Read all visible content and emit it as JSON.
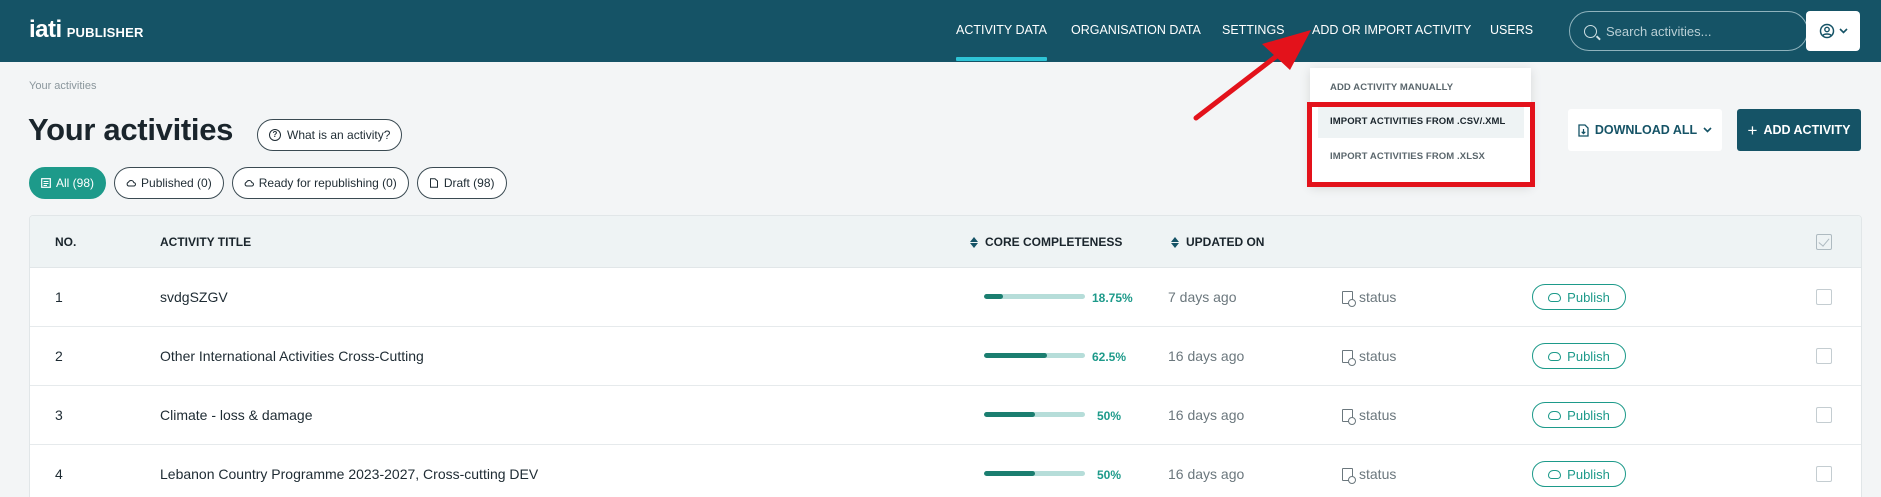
{
  "header": {
    "logo_main": "iati",
    "logo_sub": "PUBLISHER",
    "nav": [
      {
        "label": "ACTIVITY DATA",
        "active": true
      },
      {
        "label": "ORGANISATION DATA",
        "active": false
      },
      {
        "label": "SETTINGS",
        "active": false
      },
      {
        "label": "ADD OR IMPORT ACTIVITY",
        "active": false
      },
      {
        "label": "USERS",
        "active": false
      }
    ],
    "search_placeholder": "Search activities...",
    "user_icon": "user-circle-icon"
  },
  "dropdown": {
    "items": [
      {
        "label": "ADD ACTIVITY MANUALLY"
      },
      {
        "label": "IMPORT ACTIVITIES FROM .CSV/.XML"
      },
      {
        "label": "IMPORT ACTIVITIES FROM .XLSX"
      }
    ]
  },
  "breadcrumb": "Your activities",
  "page_title": "Your activities",
  "what_button": "What is an activity?",
  "filters": [
    {
      "label": "All (98)",
      "active": true
    },
    {
      "label": "Published (0)",
      "active": false
    },
    {
      "label": "Ready for republishing (0)",
      "active": false
    },
    {
      "label": "Draft (98)",
      "active": false
    }
  ],
  "actions": {
    "download": "DOWNLOAD ALL",
    "add": "ADD ACTIVITY"
  },
  "table": {
    "headers": {
      "no": "NO.",
      "title": "ACTIVITY TITLE",
      "completeness": "CORE COMPLETENESS",
      "updated": "UPDATED ON"
    },
    "rows": [
      {
        "no": "1",
        "title": "svdgSZGV",
        "completeness": 0.1875,
        "completeness_label": "18.75%",
        "updated": "7 days ago",
        "status": "status",
        "action": "Publish"
      },
      {
        "no": "2",
        "title": "Other International Activities Cross-Cutting",
        "completeness": 0.625,
        "completeness_label": "62.5%",
        "updated": "16 days ago",
        "status": "status",
        "action": "Publish"
      },
      {
        "no": "3",
        "title": "Climate - loss & damage",
        "completeness": 0.5,
        "completeness_label": "50%",
        "updated": "16 days ago",
        "status": "status",
        "action": "Publish"
      },
      {
        "no": "4",
        "title": "Lebanon Country Programme 2023-2027, Cross-cutting DEV",
        "completeness": 0.5,
        "completeness_label": "50%",
        "updated": "16 days ago",
        "status": "status",
        "action": "Publish"
      }
    ]
  },
  "colors": {
    "header_bg": "#155366",
    "accent": "#1d9a8a",
    "active_underline": "#2ec4d6",
    "annotation_red": "#e3121b"
  }
}
